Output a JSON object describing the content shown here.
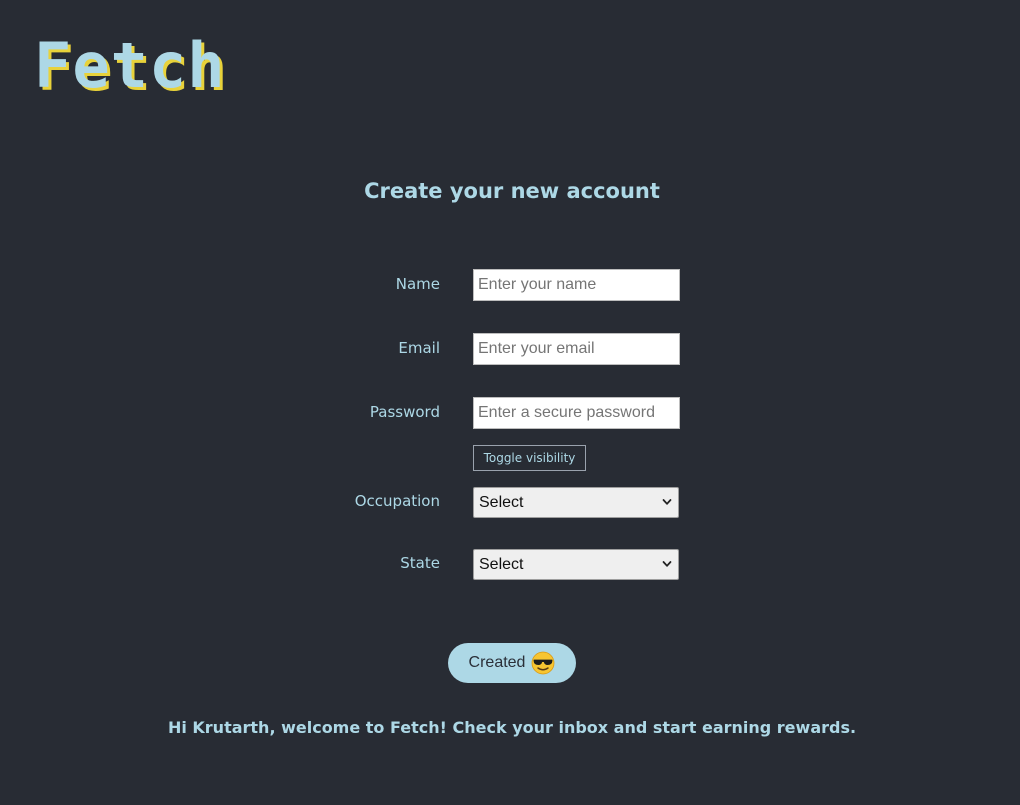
{
  "brand": {
    "logo_text": "Fetch",
    "color": "#add8e6",
    "shadow_color": "#e8d23a"
  },
  "form": {
    "title": "Create your new account",
    "name": {
      "label": "Name",
      "placeholder": "Enter your name",
      "value": ""
    },
    "email": {
      "label": "Email",
      "placeholder": "Enter your email",
      "value": ""
    },
    "password": {
      "label": "Password",
      "placeholder": "Enter a secure password",
      "value": ""
    },
    "toggle_visibility_label": "Toggle visibility",
    "occupation": {
      "label": "Occupation",
      "selected": "Select"
    },
    "state": {
      "label": "State",
      "selected": "Select"
    },
    "submit": {
      "label": "Created",
      "icon": "smiling-face-with-sunglasses-icon"
    }
  },
  "welcome_message": "Hi Krutarth, welcome to Fetch! Check your inbox and start earning rewards.",
  "colors": {
    "background": "#282c34",
    "accent": "#add8e6"
  }
}
